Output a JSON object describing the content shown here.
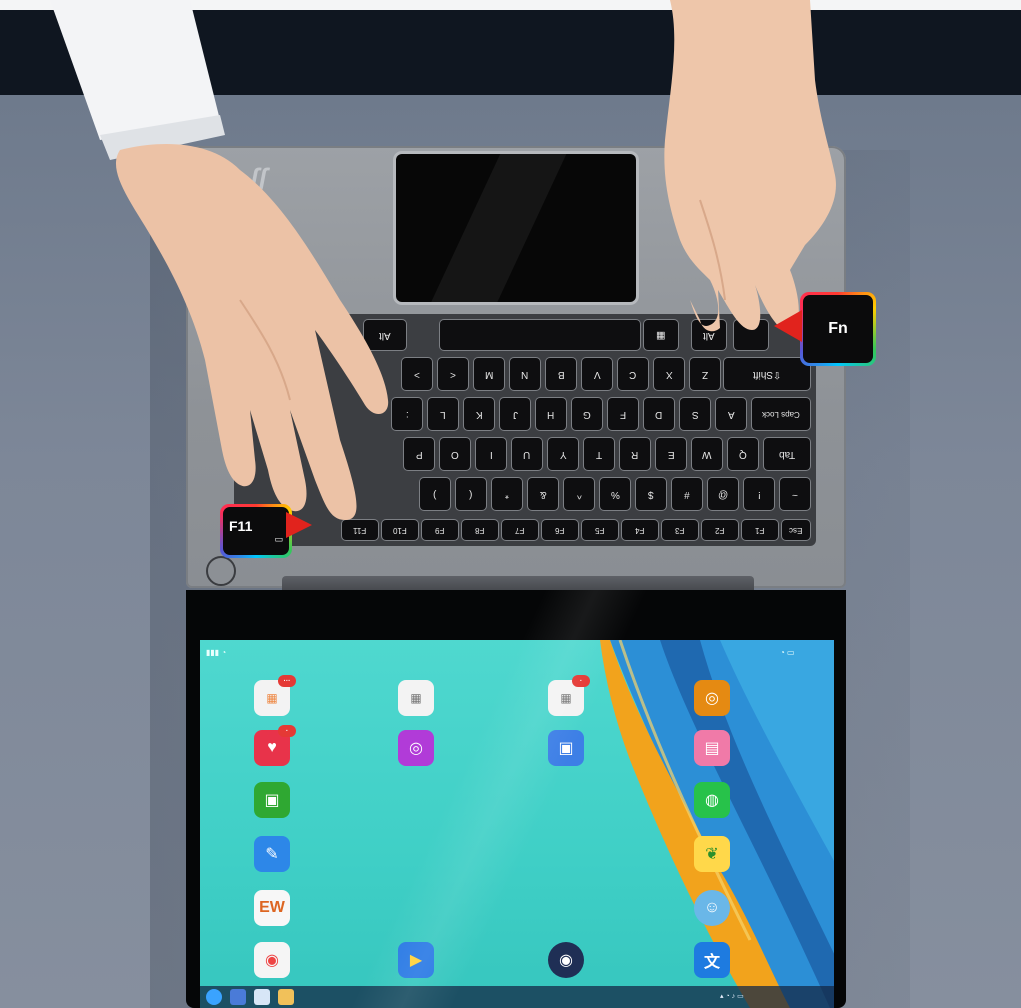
{
  "callouts": {
    "fn_label": "Fn",
    "f11_label": "F11"
  },
  "keyboard": {
    "space_row": [
      "Alt",
      "",
      "Alt",
      ""
    ],
    "shift_row": [
      "⇧Shift",
      "Z",
      "X",
      "C",
      "V",
      "B",
      "N",
      "M",
      "<",
      ">"
    ],
    "caps_row": [
      "Caps Lock",
      "A",
      "S",
      "D",
      "F",
      "G",
      "H",
      "J",
      "K",
      "L",
      ":"
    ],
    "tab_row": [
      "Tab",
      "Q",
      "W",
      "E",
      "R",
      "T",
      "Y",
      "U",
      "I",
      "O",
      "P"
    ],
    "num_row": [
      "~",
      "!",
      "@",
      "#",
      "$",
      "%",
      "^",
      "&",
      "*",
      "(",
      ")"
    ],
    "f_row": [
      "Esc",
      "F1",
      "F2",
      "F3",
      "F4",
      "F5",
      "F6",
      "F7",
      "F8",
      "F9",
      "F10",
      "F11"
    ]
  },
  "colors": {
    "background_top": "#0f1620",
    "desk": "#7d8798",
    "laptop_body": "#9da1a6",
    "key": "#0e0e10",
    "screen_bg": "#3fcfc6",
    "feather_blue": "#2f8fd0",
    "feather_orange": "#f0a21c"
  },
  "icons": {
    "windows_key": "windows-logo-icon",
    "arrow": "red-triangle-pointer-icon",
    "power": "power-button-icon"
  }
}
